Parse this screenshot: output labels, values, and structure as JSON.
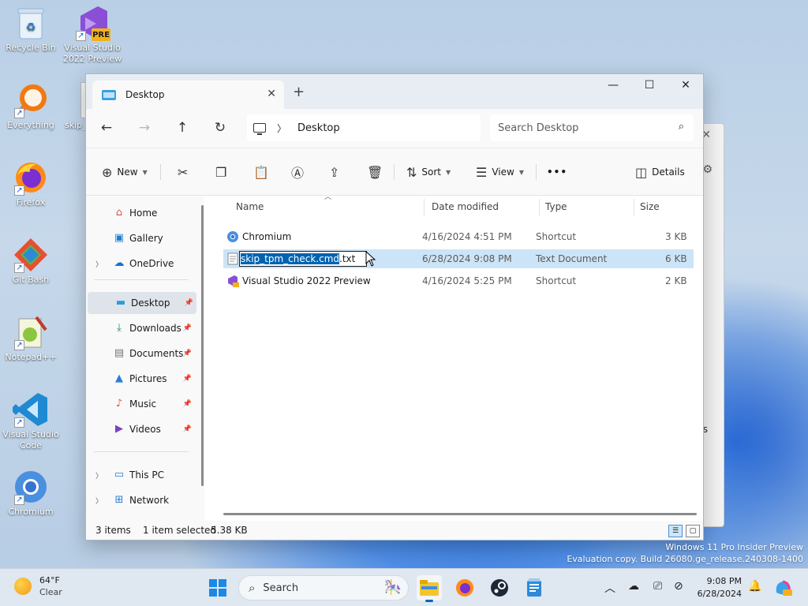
{
  "desktop_icons": [
    {
      "label": "Recycle Bin"
    },
    {
      "label": "Visual Studio 2022 Preview",
      "badge": "PRE"
    },
    {
      "label": "Everything"
    },
    {
      "label": "skip_"
    },
    {
      "label": "Firefox"
    },
    {
      "label": "Git Bash"
    },
    {
      "label": "Notepad++"
    },
    {
      "label": "Visual Studio Code"
    },
    {
      "label": "Chromium"
    }
  ],
  "explorer": {
    "tab_title": "Desktop",
    "breadcrumb": "Desktop",
    "search_placeholder": "Search Desktop",
    "toolbar": {
      "new_label": "New",
      "sort_label": "Sort",
      "view_label": "View",
      "more_label": "•••",
      "details_label": "Details"
    },
    "nav": {
      "home": "Home",
      "gallery": "Gallery",
      "onedrive": "OneDrive",
      "desktop": "Desktop",
      "downloads": "Downloads",
      "documents": "Documents",
      "pictures": "Pictures",
      "music": "Music",
      "videos": "Videos",
      "this_pc": "This PC",
      "network": "Network"
    },
    "columns": {
      "name": "Name",
      "date": "Date modified",
      "type": "Type",
      "size": "Size"
    },
    "files": [
      {
        "name": "Chromium",
        "date": "4/16/2024 4:51 PM",
        "type": "Shortcut",
        "size": "3 KB"
      },
      {
        "name": "skip_tpm_check.cmd.txt",
        "rename_selected": "skip_tpm_check.cmd",
        "rename_rest": ".txt",
        "date": "6/28/2024 9:08 PM",
        "type": "Text Document",
        "size": "6 KB"
      },
      {
        "name": "Visual Studio 2022 Preview",
        "date": "4/16/2024 5:25 PM",
        "type": "Shortcut",
        "size": "2 KB"
      }
    ],
    "status": {
      "count": "3 items",
      "selection": "1 item selected",
      "size": "5.38 KB"
    }
  },
  "background_window": {
    "trailing_text": "s"
  },
  "watermark": {
    "line1": "Windows 11 Pro Insider Preview",
    "line2": "Evaluation copy. Build 26080.ge_release.240308-1400"
  },
  "taskbar": {
    "weather_temp": "64°F",
    "weather_cond": "Clear",
    "search_placeholder": "Search",
    "time": "9:08 PM",
    "date": "6/28/2024",
    "pinned": [
      "start-icon",
      "file-explorer-icon",
      "firefox-icon",
      "steam-icon",
      "notepad-icon"
    ]
  },
  "colors": {
    "accent": "#0067c0",
    "selection": "#cce4f7",
    "rename_highlight": "#0063b1"
  }
}
